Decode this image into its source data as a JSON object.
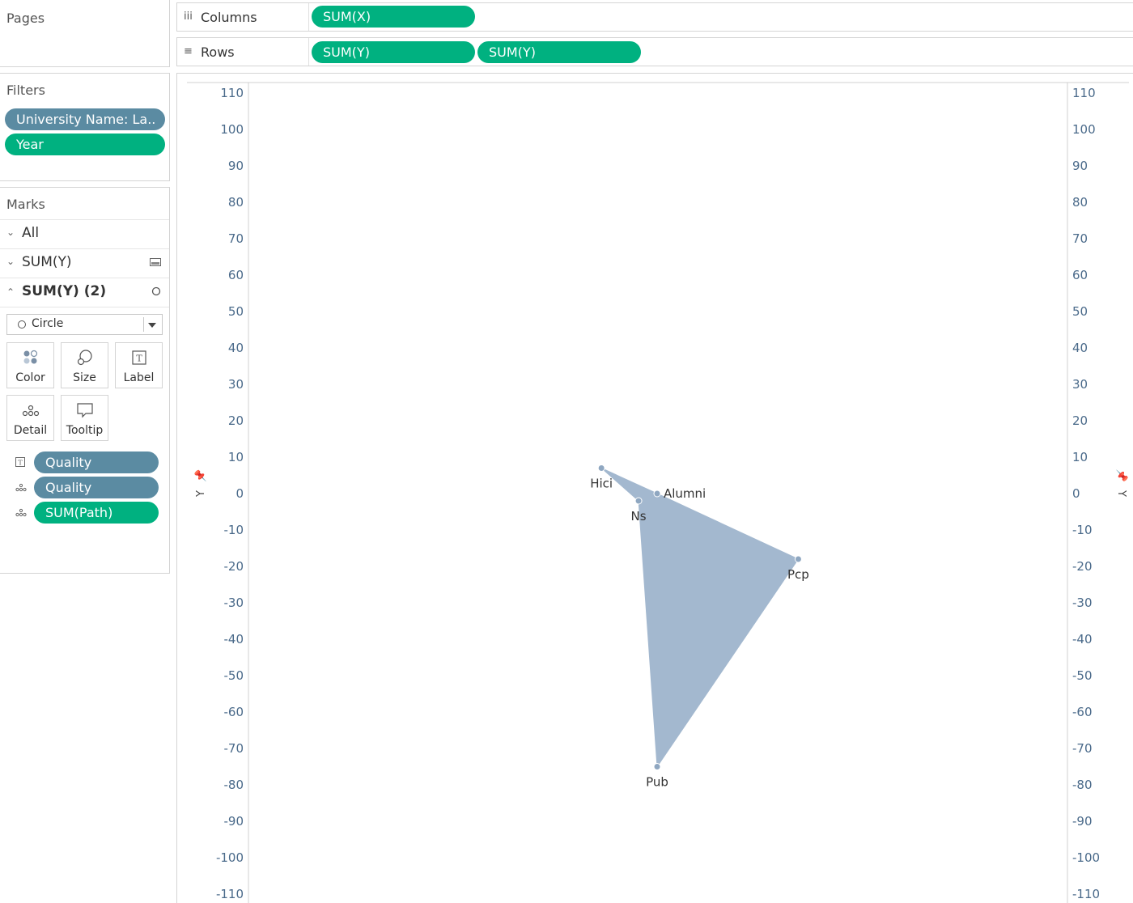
{
  "pages_panel": {
    "title": "Pages"
  },
  "filters_panel": {
    "title": "Filters",
    "items": [
      {
        "label": "University Name: La..",
        "color": "#5b8ba2"
      },
      {
        "label": "Year",
        "color": "#00b180"
      }
    ]
  },
  "marks_panel": {
    "title": "Marks",
    "layers": [
      {
        "label": "All",
        "expanded": false,
        "icon": "none"
      },
      {
        "label": "SUM(Y)",
        "expanded": false,
        "icon": "area-mark-icon"
      },
      {
        "label": "SUM(Y) (2)",
        "expanded": true,
        "icon": "circle-mark-icon"
      }
    ],
    "mark_type": "Circle",
    "buttons": [
      {
        "label": "Color",
        "icon": "color-icon"
      },
      {
        "label": "Size",
        "icon": "size-icon"
      },
      {
        "label": "Label",
        "icon": "label-icon"
      },
      {
        "label": "Detail",
        "icon": "detail-icon"
      },
      {
        "label": "Tooltip",
        "icon": "tooltip-icon"
      }
    ],
    "fields": [
      {
        "label": "Quality",
        "type": "label",
        "color": "#5b8ba2"
      },
      {
        "label": "Quality",
        "type": "detail",
        "color": "#5b8ba2"
      },
      {
        "label": "SUM(Path)",
        "type": "detail",
        "color": "#00b180"
      }
    ]
  },
  "columns_shelf": {
    "label": "Columns",
    "pills": [
      "SUM(X)"
    ]
  },
  "rows_shelf": {
    "label": "Rows",
    "pills": [
      "SUM(Y)",
      "SUM(Y)"
    ]
  },
  "colors": {
    "measure_pill": "#00b180",
    "dimension_pill": "#5b8ba2",
    "mark_fill": "#a3b8cf",
    "mark_point": "#8fa7c1",
    "tick_text": "#4a6a8a"
  },
  "chart_data": {
    "type": "area",
    "xlabel": "",
    "ylabel": "Y",
    "y2label": "Y",
    "ylim": [
      -110,
      110
    ],
    "xlim": [
      -110,
      110
    ],
    "yticks": [
      110,
      100,
      90,
      80,
      70,
      60,
      50,
      40,
      30,
      20,
      10,
      0,
      -10,
      -20,
      -30,
      -40,
      -50,
      -60,
      -70,
      -80,
      -90,
      -100,
      -110
    ],
    "grid": false,
    "points": [
      {
        "name": "Hici",
        "x": -15,
        "y": 7
      },
      {
        "name": "Alumni",
        "x": 0,
        "y": 0
      },
      {
        "name": "Pcp",
        "x": 38,
        "y": -18
      },
      {
        "name": "Pub",
        "x": 0,
        "y": -75
      },
      {
        "name": "Ns",
        "x": -5,
        "y": -2
      }
    ],
    "path_order": [
      "Hici",
      "Alumni",
      "Pcp",
      "Pub",
      "Ns"
    ]
  }
}
